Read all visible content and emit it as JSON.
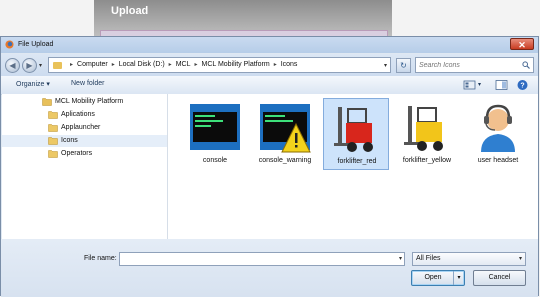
{
  "background": {
    "title": "Upload"
  },
  "window": {
    "title": "File Upload",
    "close": "✕"
  },
  "address": {
    "crumbs": [
      "Computer",
      "Local Disk (D:)",
      "MCL",
      "MCL Mobility Platform",
      "Icons"
    ],
    "search_placeholder": "Search Icons"
  },
  "toolbar": {
    "organize": "Organize ▾",
    "new_folder": "New folder"
  },
  "tree": {
    "items": [
      {
        "label": "MCL Mobility Platform"
      },
      {
        "label": "Aplications"
      },
      {
        "label": "Applauncher"
      },
      {
        "label": "Icons"
      },
      {
        "label": "Operators"
      }
    ]
  },
  "files": [
    {
      "name": "console",
      "icon": "console-icon"
    },
    {
      "name": "console_warning",
      "icon": "console-warning-icon"
    },
    {
      "name": "forklifter_red",
      "icon": "forklift-red-icon"
    },
    {
      "name": "forklifter_yellow",
      "icon": "forklift-yellow-icon"
    },
    {
      "name": "user headset",
      "icon": "user-headset-icon"
    }
  ],
  "bottom": {
    "file_name_label": "File name:",
    "file_name_value": "",
    "filter": "All Files",
    "open": "Open",
    "cancel": "Cancel"
  },
  "colors": {
    "accent": "#3c7fb1",
    "selection": "#cde3fb",
    "close": "#c83c22"
  }
}
